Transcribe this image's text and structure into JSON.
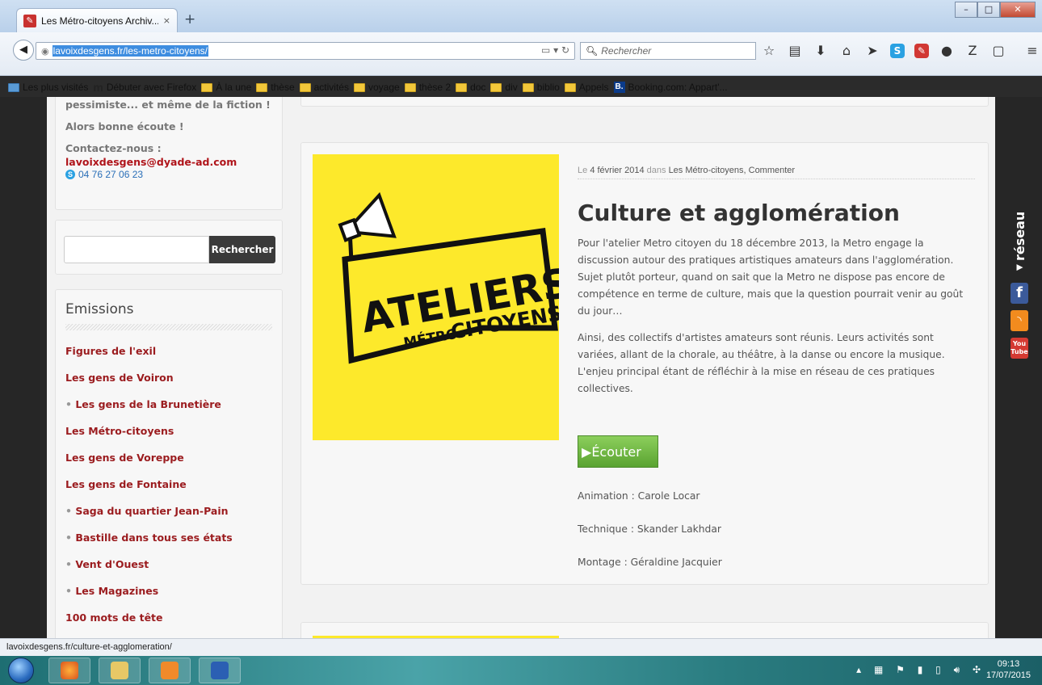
{
  "browser": {
    "tab_title": "Les Métro-citoyens Archiv...",
    "tab_close": "×",
    "new_tab": "+",
    "url": "lavoixdesgens.fr/les-metro-citoyens/",
    "search_placeholder": "Rechercher",
    "bookmarks": [
      "Les plus visités",
      "Débuter avec Firefox",
      "À la une",
      "thèse",
      "activités",
      "voyage",
      "thèse 2",
      "doc",
      "div",
      "biblio",
      "Appels",
      "Booking.com: Appart'..."
    ]
  },
  "sidebar": {
    "intro_tail": "pessimiste... et même de la fiction !",
    "greeting": "Alors bonne écoute !",
    "contact_label": "Contactez-nous :",
    "contact_email": "lavoixdesgens@dyade-ad.com",
    "contact_phone": "04 76 27 06 23",
    "search_button": "Rechercher",
    "emissions_title": "Emissions",
    "emissions": [
      {
        "label": "Figures de l'exil",
        "sub": false
      },
      {
        "label": "Les gens de Voiron",
        "sub": false
      },
      {
        "label": "Les gens de la Brunetière",
        "sub": true
      },
      {
        "label": "Les Métro-citoyens",
        "sub": false
      },
      {
        "label": "Les gens de Voreppe",
        "sub": false
      },
      {
        "label": "Les gens de Fontaine",
        "sub": false
      },
      {
        "label": "Saga du quartier Jean-Pain",
        "sub": true
      },
      {
        "label": "Bastille dans tous ses états",
        "sub": true
      },
      {
        "label": "Vent d'Ouest",
        "sub": true
      },
      {
        "label": "Les Magazines",
        "sub": true
      },
      {
        "label": "100 mots de tête",
        "sub": false
      }
    ]
  },
  "post": {
    "image_text_1": "ATELIERS",
    "image_text_2": "MÉTRO",
    "image_text_3": "CITOYENS",
    "meta_prefix": "Le",
    "meta_date": "4 février 2014",
    "meta_in": "dans",
    "meta_category": "Les Métro-citoyens",
    "meta_comment": "Commenter",
    "title": "Culture et agglomération",
    "paragraph_1": "Pour l'atelier Metro citoyen du 18 décembre 2013, la Metro engage la discussion autour des pratiques artistiques amateurs dans l'agglomération. Sujet plutôt porteur, quand on sait que la Metro ne dispose pas encore de compétence en terme de culture, mais que la question pourrait venir au goût du jour…",
    "paragraph_2": "Ainsi, des collectifs d'artistes amateurs sont réunis. Leurs activités sont variées, allant de la chorale, au théâtre, à la danse ou encore la musique. L'enjeu principal étant de réfléchir à la mise en réseau de ces pratiques collectives.",
    "listen_label": "Écouter",
    "credit_animation": "Animation : Carole Locar",
    "credit_technique": "Technique : Skander Lakhdar",
    "credit_montage": "Montage : Géraldine Jacquier"
  },
  "social": {
    "reseau_label": "◂réseau",
    "fb": "f",
    "yt_line1": "You",
    "yt_line2": "Tube"
  },
  "status_url": "lavoixdesgens.fr/culture-et-agglomeration/",
  "clock": {
    "time": "09:13",
    "date": "17/07/2015"
  }
}
